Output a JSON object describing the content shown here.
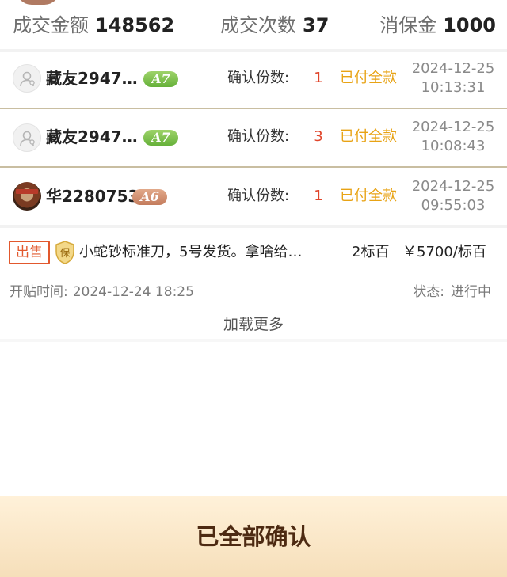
{
  "stats": {
    "amount_label": "成交金额",
    "amount_value": "148562",
    "count_label": "成交次数",
    "count_value": "37",
    "deposit_label": "消保金",
    "deposit_value": "1000"
  },
  "confirmations": [
    {
      "name": "藏友2947…",
      "level": "A7",
      "qty_label": "确认份数:",
      "qty": "1",
      "status": "已付全款",
      "date": "2024-12-25",
      "time": "10:13:31",
      "avatar": "default-avatar-icon"
    },
    {
      "name": "藏友2947…",
      "level": "A7",
      "qty_label": "确认份数:",
      "qty": "3",
      "status": "已付全款",
      "date": "2024-12-25",
      "time": "10:08:43",
      "avatar": "default-avatar-icon"
    },
    {
      "name": "华2280753",
      "level": "A6",
      "qty_label": "确认份数:",
      "qty": "1",
      "status": "已付全款",
      "date": "2024-12-25",
      "time": "09:55:03",
      "avatar": "user-photo"
    }
  ],
  "listing": {
    "sell_tag": "出售",
    "guarantee_tag": "保",
    "title": "小蛇钞标准刀，5号发货。拿啥给…",
    "quantity": "2标百",
    "price": "￥5700/标百",
    "open_time_label": "开贴时间:",
    "open_time_value": "2024-12-24 18:25",
    "status_label": "状态:",
    "status_value": "进行中"
  },
  "load_more": "加载更多",
  "confirm_all": "已全部确认",
  "colors": {
    "qty_red": "#e0452b",
    "paid_orange": "#e8a315",
    "sell_tag": "#e2582d",
    "badge_a7": "#66b13a",
    "badge_a6": "#c47c5d",
    "bottom_bar": "#f6dfba",
    "button_text": "#4d2a12"
  }
}
